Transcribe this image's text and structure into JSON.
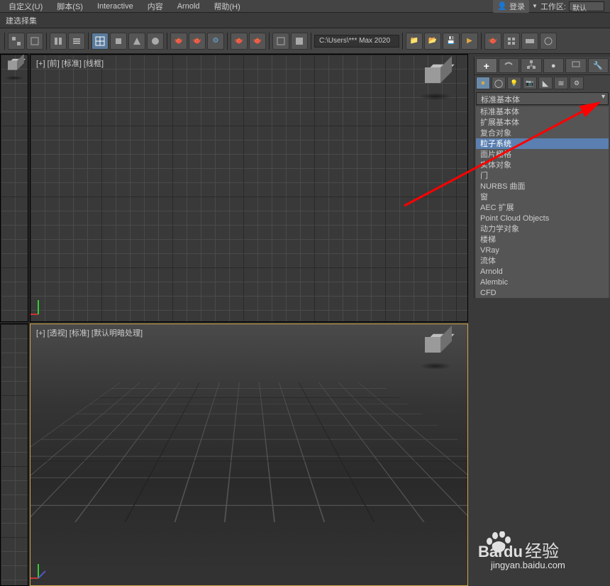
{
  "menu": {
    "items": [
      "自定义(U)",
      "脚本(S)",
      "Interactive",
      "内容",
      "Arnold",
      "帮助(H)"
    ],
    "login_label": "登录",
    "workspace_label": "工作区:",
    "workspace_value": "默认"
  },
  "status": {
    "selection_label": "建选择集"
  },
  "toolbar": {
    "path": "C:\\Users\\*** Max 2020"
  },
  "viewports": {
    "top": {
      "label": "[+] [前] [标准] [线框]"
    },
    "perspective": {
      "label": "[+] [透视] [标准] [默认明暗处理]"
    }
  },
  "command_panel": {
    "dropdown_selected": "标准基本体",
    "categories": [
      {
        "label": "标准基本体",
        "selected": false
      },
      {
        "label": "扩展基本体",
        "selected": false
      },
      {
        "label": "复合对象",
        "selected": false
      },
      {
        "label": "粒子系统",
        "selected": true
      },
      {
        "label": "面片栅格",
        "selected": false
      },
      {
        "label": "实体对象",
        "selected": false
      },
      {
        "label": "门",
        "selected": false
      },
      {
        "label": "NURBS 曲面",
        "selected": false
      },
      {
        "label": "窗",
        "selected": false
      },
      {
        "label": "AEC 扩展",
        "selected": false
      },
      {
        "label": "Point Cloud Objects",
        "selected": false
      },
      {
        "label": "动力学对象",
        "selected": false
      },
      {
        "label": "楼梯",
        "selected": false
      },
      {
        "label": "VRay",
        "selected": false
      },
      {
        "label": "流体",
        "selected": false
      },
      {
        "label": "Arnold",
        "selected": false
      },
      {
        "label": "Alembic",
        "selected": false
      },
      {
        "label": "CFD",
        "selected": false
      }
    ]
  },
  "watermark": {
    "brand": "Baidu 经验",
    "url": "jingyan.baidu.com"
  },
  "icons": {
    "create": "+",
    "modify": "☰",
    "hierarchy": "◫",
    "motion": "●",
    "display": "▭",
    "utilities": "🔧",
    "geometry": "●",
    "shapes": "◯",
    "lights": "💡",
    "cameras": "📷",
    "helpers": "◣",
    "spacewarps": "≋",
    "systems": "⚙"
  }
}
